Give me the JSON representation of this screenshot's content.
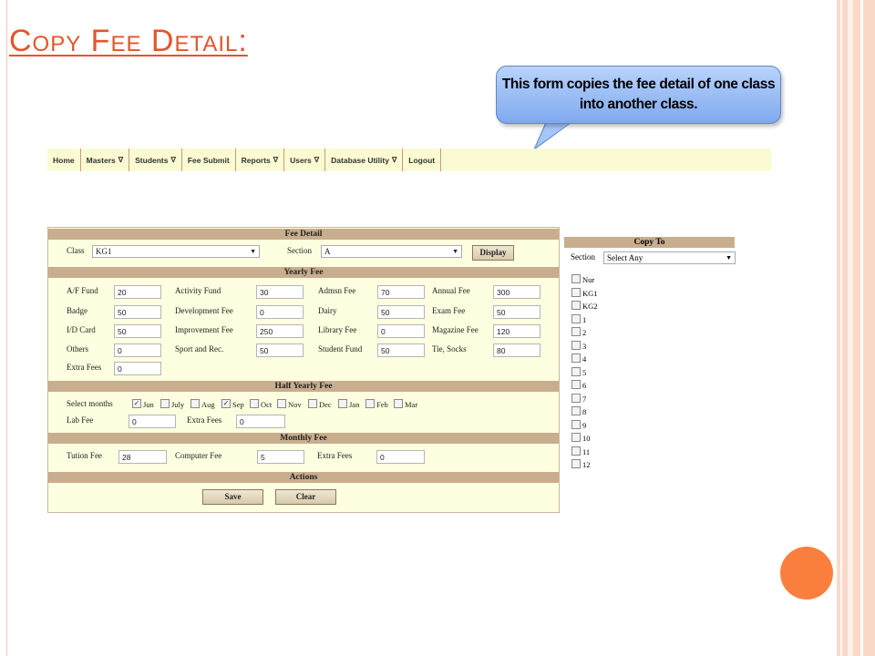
{
  "slide": {
    "title": "Copy Fee Detail:",
    "callout": "This form copies the fee detail of one class into another class."
  },
  "menu": [
    {
      "label": "Home",
      "has_dropdown": false
    },
    {
      "label": "Masters",
      "has_dropdown": true
    },
    {
      "label": "Students",
      "has_dropdown": true
    },
    {
      "label": "Fee Submit",
      "has_dropdown": false
    },
    {
      "label": "Reports",
      "has_dropdown": true
    },
    {
      "label": "Users",
      "has_dropdown": true
    },
    {
      "label": "Database Utility",
      "has_dropdown": true
    },
    {
      "label": "Logout",
      "has_dropdown": false
    }
  ],
  "caret": "∇",
  "form": {
    "fee_detail_header": "Fee Detail",
    "class_label": "Class",
    "class_value": "KG1",
    "section_label": "Section",
    "section_value": "A",
    "display_button": "Display",
    "yearly_header": "Yearly Fee",
    "yearly_fields": [
      {
        "label": "A/F Fund",
        "value": "20"
      },
      {
        "label": "Activity Fund",
        "value": "30"
      },
      {
        "label": "Admsn Fee",
        "value": "70"
      },
      {
        "label": "Annual Fee",
        "value": "300"
      },
      {
        "label": "Badge",
        "value": "50"
      },
      {
        "label": "Development Fee",
        "value": "0"
      },
      {
        "label": "Dairy",
        "value": "50"
      },
      {
        "label": "Exam Fee",
        "value": "50"
      },
      {
        "label": "I/D Card",
        "value": "50"
      },
      {
        "label": "Improvement Fee",
        "value": "250"
      },
      {
        "label": "Library Fee",
        "value": "0"
      },
      {
        "label": "Magazine Fee",
        "value": "120"
      },
      {
        "label": "Others",
        "value": "0"
      },
      {
        "label": "Sport and Rec.",
        "value": "50"
      },
      {
        "label": "Student Fund",
        "value": "50"
      },
      {
        "label": "Tie, Socks",
        "value": "80"
      },
      {
        "label": "Extra Fees",
        "value": "0"
      }
    ],
    "half_yearly_header": "Half Yearly Fee",
    "select_months_label": "Select months",
    "months": [
      {
        "label": "Jun",
        "checked": true
      },
      {
        "label": "July",
        "checked": false
      },
      {
        "label": "Aug",
        "checked": false
      },
      {
        "label": "Sep",
        "checked": true
      },
      {
        "label": "Oct",
        "checked": false
      },
      {
        "label": "Nov",
        "checked": false
      },
      {
        "label": "Dec",
        "checked": false
      },
      {
        "label": "Jan",
        "checked": false
      },
      {
        "label": "Feb",
        "checked": false
      },
      {
        "label": "Mar",
        "checked": false
      }
    ],
    "lab_fee_label": "Lab Fee",
    "lab_fee_value": "0",
    "half_extra_label": "Extra Fees",
    "half_extra_value": "0",
    "monthly_header": "Monthly Fee",
    "tution_label": "Tution Fee",
    "tution_value": "28",
    "computer_label": "Computer Fee",
    "computer_value": "5",
    "monthly_extra_label": "Extra Fees",
    "monthly_extra_value": "0",
    "actions_header": "Actions",
    "save_button": "Save",
    "clear_button": "Clear"
  },
  "copy_to": {
    "header": "Copy To",
    "section_label": "Section",
    "section_value": "Select Any",
    "classes": [
      "Nur",
      "KG1",
      "KG2",
      "1",
      "2",
      "3",
      "4",
      "5",
      "6",
      "7",
      "8",
      "9",
      "10",
      "11",
      "12"
    ]
  }
}
